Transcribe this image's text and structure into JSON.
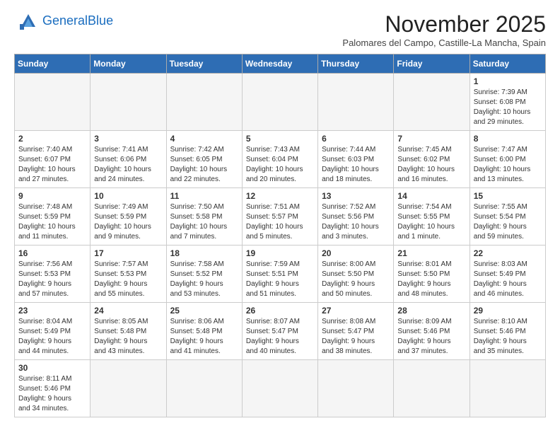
{
  "header": {
    "logo_general": "General",
    "logo_blue": "Blue",
    "month_title": "November 2025",
    "subtitle": "Palomares del Campo, Castille-La Mancha, Spain"
  },
  "weekdays": [
    "Sunday",
    "Monday",
    "Tuesday",
    "Wednesday",
    "Thursday",
    "Friday",
    "Saturday"
  ],
  "weeks": [
    [
      {
        "day": "",
        "info": ""
      },
      {
        "day": "",
        "info": ""
      },
      {
        "day": "",
        "info": ""
      },
      {
        "day": "",
        "info": ""
      },
      {
        "day": "",
        "info": ""
      },
      {
        "day": "",
        "info": ""
      },
      {
        "day": "1",
        "info": "Sunrise: 7:39 AM\nSunset: 6:08 PM\nDaylight: 10 hours\nand 29 minutes."
      }
    ],
    [
      {
        "day": "2",
        "info": "Sunrise: 7:40 AM\nSunset: 6:07 PM\nDaylight: 10 hours\nand 27 minutes."
      },
      {
        "day": "3",
        "info": "Sunrise: 7:41 AM\nSunset: 6:06 PM\nDaylight: 10 hours\nand 24 minutes."
      },
      {
        "day": "4",
        "info": "Sunrise: 7:42 AM\nSunset: 6:05 PM\nDaylight: 10 hours\nand 22 minutes."
      },
      {
        "day": "5",
        "info": "Sunrise: 7:43 AM\nSunset: 6:04 PM\nDaylight: 10 hours\nand 20 minutes."
      },
      {
        "day": "6",
        "info": "Sunrise: 7:44 AM\nSunset: 6:03 PM\nDaylight: 10 hours\nand 18 minutes."
      },
      {
        "day": "7",
        "info": "Sunrise: 7:45 AM\nSunset: 6:02 PM\nDaylight: 10 hours\nand 16 minutes."
      },
      {
        "day": "8",
        "info": "Sunrise: 7:47 AM\nSunset: 6:00 PM\nDaylight: 10 hours\nand 13 minutes."
      }
    ],
    [
      {
        "day": "9",
        "info": "Sunrise: 7:48 AM\nSunset: 5:59 PM\nDaylight: 10 hours\nand 11 minutes."
      },
      {
        "day": "10",
        "info": "Sunrise: 7:49 AM\nSunset: 5:59 PM\nDaylight: 10 hours\nand 9 minutes."
      },
      {
        "day": "11",
        "info": "Sunrise: 7:50 AM\nSunset: 5:58 PM\nDaylight: 10 hours\nand 7 minutes."
      },
      {
        "day": "12",
        "info": "Sunrise: 7:51 AM\nSunset: 5:57 PM\nDaylight: 10 hours\nand 5 minutes."
      },
      {
        "day": "13",
        "info": "Sunrise: 7:52 AM\nSunset: 5:56 PM\nDaylight: 10 hours\nand 3 minutes."
      },
      {
        "day": "14",
        "info": "Sunrise: 7:54 AM\nSunset: 5:55 PM\nDaylight: 10 hours\nand 1 minute."
      },
      {
        "day": "15",
        "info": "Sunrise: 7:55 AM\nSunset: 5:54 PM\nDaylight: 9 hours\nand 59 minutes."
      }
    ],
    [
      {
        "day": "16",
        "info": "Sunrise: 7:56 AM\nSunset: 5:53 PM\nDaylight: 9 hours\nand 57 minutes."
      },
      {
        "day": "17",
        "info": "Sunrise: 7:57 AM\nSunset: 5:53 PM\nDaylight: 9 hours\nand 55 minutes."
      },
      {
        "day": "18",
        "info": "Sunrise: 7:58 AM\nSunset: 5:52 PM\nDaylight: 9 hours\nand 53 minutes."
      },
      {
        "day": "19",
        "info": "Sunrise: 7:59 AM\nSunset: 5:51 PM\nDaylight: 9 hours\nand 51 minutes."
      },
      {
        "day": "20",
        "info": "Sunrise: 8:00 AM\nSunset: 5:50 PM\nDaylight: 9 hours\nand 50 minutes."
      },
      {
        "day": "21",
        "info": "Sunrise: 8:01 AM\nSunset: 5:50 PM\nDaylight: 9 hours\nand 48 minutes."
      },
      {
        "day": "22",
        "info": "Sunrise: 8:03 AM\nSunset: 5:49 PM\nDaylight: 9 hours\nand 46 minutes."
      }
    ],
    [
      {
        "day": "23",
        "info": "Sunrise: 8:04 AM\nSunset: 5:49 PM\nDaylight: 9 hours\nand 44 minutes."
      },
      {
        "day": "24",
        "info": "Sunrise: 8:05 AM\nSunset: 5:48 PM\nDaylight: 9 hours\nand 43 minutes."
      },
      {
        "day": "25",
        "info": "Sunrise: 8:06 AM\nSunset: 5:48 PM\nDaylight: 9 hours\nand 41 minutes."
      },
      {
        "day": "26",
        "info": "Sunrise: 8:07 AM\nSunset: 5:47 PM\nDaylight: 9 hours\nand 40 minutes."
      },
      {
        "day": "27",
        "info": "Sunrise: 8:08 AM\nSunset: 5:47 PM\nDaylight: 9 hours\nand 38 minutes."
      },
      {
        "day": "28",
        "info": "Sunrise: 8:09 AM\nSunset: 5:46 PM\nDaylight: 9 hours\nand 37 minutes."
      },
      {
        "day": "29",
        "info": "Sunrise: 8:10 AM\nSunset: 5:46 PM\nDaylight: 9 hours\nand 35 minutes."
      }
    ],
    [
      {
        "day": "30",
        "info": "Sunrise: 8:11 AM\nSunset: 5:46 PM\nDaylight: 9 hours\nand 34 minutes."
      },
      {
        "day": "",
        "info": ""
      },
      {
        "day": "",
        "info": ""
      },
      {
        "day": "",
        "info": ""
      },
      {
        "day": "",
        "info": ""
      },
      {
        "day": "",
        "info": ""
      },
      {
        "day": "",
        "info": ""
      }
    ]
  ]
}
